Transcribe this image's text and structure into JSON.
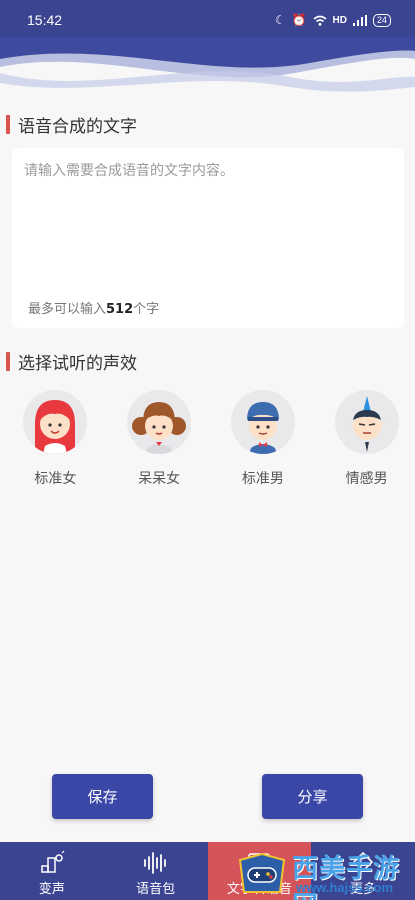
{
  "status": {
    "time": "15:42",
    "network": "HD",
    "battery": "24"
  },
  "colors": {
    "header": "#3a4491",
    "accent": "#d9534f",
    "button": "#3b47a6"
  },
  "text_section": {
    "title": "语音合成的文字",
    "placeholder": "请输入需要合成语音的文字内容。",
    "limit_prefix": "最多可以输入",
    "limit_number": "512",
    "limit_suffix": "个字"
  },
  "voice_section": {
    "title": "选择试听的声效",
    "voices": [
      {
        "label": "标准女",
        "icon": "girl-red-hair-avatar"
      },
      {
        "label": "呆呆女",
        "icon": "girl-brown-hair-avatar"
      },
      {
        "label": "标准男",
        "icon": "boy-blue-cap-avatar"
      },
      {
        "label": "情感男",
        "icon": "boy-blue-mohawk-avatar"
      }
    ]
  },
  "actions": {
    "save_label": "保存",
    "share_label": "分享"
  },
  "tabbar": {
    "tabs": [
      {
        "label": "变声",
        "icon": "voice-change-icon"
      },
      {
        "label": "语音包",
        "icon": "waveform-icon"
      },
      {
        "label": "文字转语音",
        "icon": "text-to-speech-icon"
      },
      {
        "label": "更多",
        "icon": "more-icon"
      }
    ]
  },
  "watermark": {
    "text": "西美手游网",
    "url": "www.hajss.com"
  }
}
